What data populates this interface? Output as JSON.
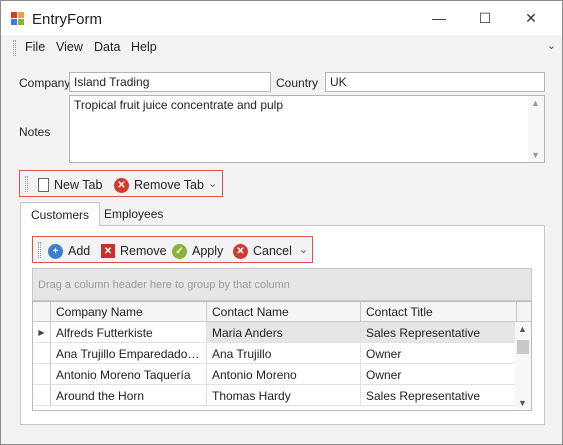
{
  "window": {
    "title": "EntryForm",
    "minimize_glyph": "—",
    "maximize_glyph": "☐",
    "close_glyph": "✕"
  },
  "menu": {
    "items": [
      "File",
      "View",
      "Data",
      "Help"
    ],
    "overflow_glyph": "⌄"
  },
  "form": {
    "company_label": "Company",
    "company_value": "Island Trading",
    "country_label": "Country",
    "country_value": "UK",
    "notes_label": "Notes",
    "notes_value": "Tropical fruit juice concentrate and pulp"
  },
  "tab_toolbar": {
    "new_tab_label": "New Tab",
    "remove_tab_label": "Remove Tab",
    "overflow_glyph": "⌄"
  },
  "tabs": [
    {
      "label": "Customers",
      "active": true
    },
    {
      "label": "Employees",
      "active": false
    }
  ],
  "grid_toolbar": {
    "add_label": "Add",
    "remove_label": "Remove",
    "apply_label": "Apply",
    "cancel_label": "Cancel",
    "overflow_glyph": "⌄"
  },
  "grid": {
    "group_panel_text": "Drag a column header here to group by that column",
    "columns": [
      "Company Name",
      "Contact Name",
      "Contact Title"
    ],
    "rows": [
      {
        "company": "Alfreds Futterkiste",
        "contact": "Maria Anders",
        "title": "Sales Representative",
        "selected": true
      },
      {
        "company": "Ana Trujillo Emparedados y helados",
        "contact": "Ana Trujillo",
        "title": "Owner",
        "selected": false
      },
      {
        "company": "Antonio Moreno Taquería",
        "contact": "Antonio Moreno",
        "title": "Owner",
        "selected": false
      },
      {
        "company": "Around the Horn",
        "contact": "Thomas Hardy",
        "title": "Sales Representative",
        "selected": false
      }
    ],
    "current_row_glyph": "▶"
  },
  "colors": {
    "toolbar_highlight": "#d9534f",
    "remove_icon": "#d33a2f",
    "add_icon": "#3c7fd1",
    "apply_icon": "#8ab23b"
  }
}
